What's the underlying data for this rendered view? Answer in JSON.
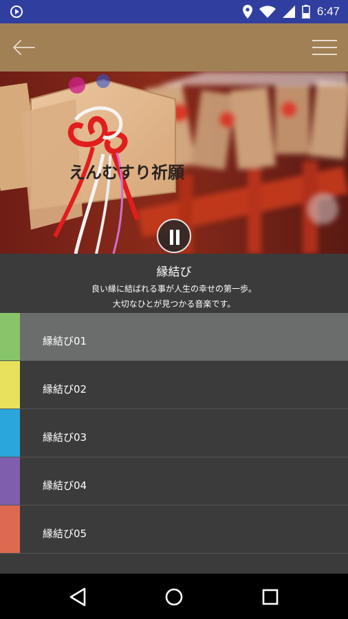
{
  "status_bar": {
    "time": "6:47",
    "icons": [
      "media-play-icon",
      "location-icon",
      "wifi-icon",
      "cell-signal-icon",
      "battery-icon"
    ]
  },
  "app_bar": {
    "background": "#a18056",
    "back_icon": "arrow-left-icon",
    "menu_icon": "hamburger-menu-icon"
  },
  "hero": {
    "image": "ema-prayer-plaques-photo",
    "plaque_text": "えんむすり祈願",
    "control_icon": "pause-icon"
  },
  "info": {
    "title": "縁結び",
    "description_line1": "良い縁に結ばれる事が人生の幸せの第一歩。",
    "description_line2": "大切なひとが見つかる音楽です。"
  },
  "tracks": [
    {
      "label": "縁結び01",
      "color": "#88c46a",
      "selected": true
    },
    {
      "label": "縁結び02",
      "color": "#e8e15c",
      "selected": false
    },
    {
      "label": "縁結び03",
      "color": "#2ba6dc",
      "selected": false
    },
    {
      "label": "縁結び04",
      "color": "#7f5fad",
      "selected": false
    },
    {
      "label": "縁結び05",
      "color": "#dd6a50",
      "selected": false
    }
  ],
  "nav_bar": {
    "icons": [
      "back-triangle-icon",
      "home-circle-icon",
      "recents-square-icon"
    ]
  }
}
